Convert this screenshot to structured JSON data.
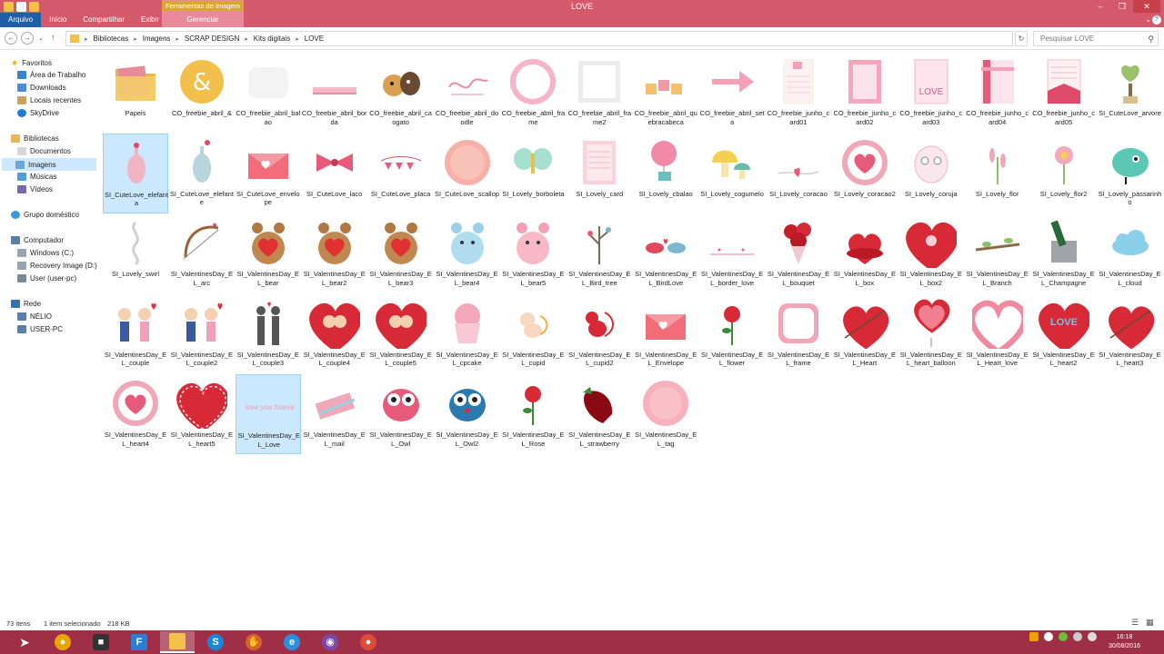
{
  "window": {
    "title": "LOVE",
    "context_group": "Ferramentas de Imagem",
    "tabs": [
      "Arquivo",
      "Início",
      "Compartilhar",
      "Exibir"
    ],
    "context_tab": "Gerenciar"
  },
  "address": {
    "segments": [
      "Bibliotecas",
      "Imagens",
      "SCRAP DESIGN",
      "Kits digitais",
      "LOVE"
    ],
    "search_placeholder": "Pesquisar LOVE"
  },
  "nav": {
    "favorites_title": "Favoritos",
    "favorites": [
      "Área de Trabalho",
      "Downloads",
      "Locais recentes",
      "SkyDrive"
    ],
    "libraries_title": "Bibliotecas",
    "libraries": [
      "Documentos",
      "Imagens",
      "Músicas",
      "Vídeos"
    ],
    "homegroup": "Grupo doméstico",
    "computer_title": "Computador",
    "computer": [
      "Windows (C:)",
      "Recovery Image (D:)",
      "User (user-pc)"
    ],
    "network_title": "Rede",
    "network": [
      "NÉLIO",
      "USER-PC"
    ]
  },
  "files": [
    {
      "name": "Papeis",
      "icon": "folder-icon"
    },
    {
      "name": "CO_freebie_abril_&",
      "icon": "ampersand-icon"
    },
    {
      "name": "CO_freebie_abril_balao",
      "icon": "blank-image-icon"
    },
    {
      "name": "CO_freebie_abril_borda",
      "icon": "border-strip-icon"
    },
    {
      "name": "CO_freebie_abril_caogato",
      "icon": "dog-cat-icon"
    },
    {
      "name": "CO_freebie_abril_doodle",
      "icon": "doodle-swirl-icon"
    },
    {
      "name": "CO_freebie_abril_frame",
      "icon": "scallop-frame-icon"
    },
    {
      "name": "CO_freebie_abril_frame2",
      "icon": "square-frame-icon"
    },
    {
      "name": "CO_freebie_abril_quebracabeca",
      "icon": "puzzle-icon"
    },
    {
      "name": "CO_freebie_abril_seta",
      "icon": "arrow-icon"
    },
    {
      "name": "CO_freebie_junho_card01",
      "icon": "card-icon"
    },
    {
      "name": "CO_freebie_junho_card02",
      "icon": "card-pink-icon"
    },
    {
      "name": "CO_freebie_junho_card03",
      "icon": "card-love-icon"
    },
    {
      "name": "CO_freebie_junho_card04",
      "icon": "card-ribbon-icon"
    },
    {
      "name": "CO_freebie_junho_card05",
      "icon": "card-lines-icon"
    },
    {
      "name": "SI_CuteLove_arvore",
      "icon": "tree-icon"
    },
    {
      "name": "SI_CuteLove_elefanta",
      "icon": "elephant-icon"
    },
    {
      "name": "SI_CuteLove_elefante",
      "icon": "elephant-blue-icon"
    },
    {
      "name": "SI_CuteLove_envelope",
      "icon": "envelope-icon"
    },
    {
      "name": "SI_CuteLove_laco",
      "icon": "bow-icon"
    },
    {
      "name": "SI_CuteLove_placa",
      "icon": "banner-icon"
    },
    {
      "name": "SI_CuteLove_scallop",
      "icon": "scallop-icon"
    },
    {
      "name": "SI_Lovely_borboleta",
      "icon": "butterfly-icon"
    },
    {
      "name": "SI_Lovely_card",
      "icon": "lined-card-icon"
    },
    {
      "name": "SI_Lovely_cbalao",
      "icon": "balloon-icon"
    },
    {
      "name": "SI_Lovely_cogumelo",
      "icon": "mushroom-icon"
    },
    {
      "name": "SI_Lovely_coracao",
      "icon": "heart-line-icon"
    },
    {
      "name": "SI_Lovely_coracao2",
      "icon": "heart-circle-icon"
    },
    {
      "name": "SI_Lovely_coruja",
      "icon": "owl-white-icon"
    },
    {
      "name": "SI_Lovely_flor",
      "icon": "flower-icon"
    },
    {
      "name": "SI_Lovely_flor2",
      "icon": "flower-pink-icon"
    },
    {
      "name": "SI_Lovely_passarinho",
      "icon": "bird-icon"
    },
    {
      "name": "SI_Lovely_swirl",
      "icon": "swirl-icon"
    },
    {
      "name": "SI_ValentinesDay_EL_arc",
      "icon": "bow-arrow-icon"
    },
    {
      "name": "SI_ValentinesDay_EL_bear",
      "icon": "bear-icon"
    },
    {
      "name": "SI_ValentinesDay_EL_bear2",
      "icon": "bear-icon"
    },
    {
      "name": "SI_ValentinesDay_EL_bear3",
      "icon": "bear-icon"
    },
    {
      "name": "SI_ValentinesDay_EL_bear4",
      "icon": "bear-blue-icon"
    },
    {
      "name": "SI_ValentinesDay_EL_bear5",
      "icon": "bear-pink-icon"
    },
    {
      "name": "SI_ValentinesDay_EL_Bird_tree",
      "icon": "bird-tree-icon"
    },
    {
      "name": "SI_ValentinesDay_EL_BirdLove",
      "icon": "birds-icon"
    },
    {
      "name": "SI_ValentinesDay_EL_border_love",
      "icon": "border-love-icon"
    },
    {
      "name": "SI_ValentinesDay_EL_bouquet",
      "icon": "bouquet-icon"
    },
    {
      "name": "SI_ValentinesDay_EL_box",
      "icon": "heart-box-icon"
    },
    {
      "name": "SI_ValentinesDay_EL_box2",
      "icon": "heart-box-bow-icon"
    },
    {
      "name": "SI_ValentinesDay_EL_Branch",
      "icon": "branch-icon"
    },
    {
      "name": "SI_ValentinesDay_EL_Champagne",
      "icon": "champagne-icon"
    },
    {
      "name": "SI_ValentinesDay_EL_cloud",
      "icon": "cloud-icon"
    },
    {
      "name": "SI_ValentinesDay_EL_couple",
      "icon": "couple-icon"
    },
    {
      "name": "SI_ValentinesDay_EL_couple2",
      "icon": "couple-icon"
    },
    {
      "name": "SI_ValentinesDay_EL_couple3",
      "icon": "silhouette-icon"
    },
    {
      "name": "SI_ValentinesDay_EL_couple4",
      "icon": "kiss-heart-icon"
    },
    {
      "name": "SI_ValentinesDay_EL_couple5",
      "icon": "kiss-heart-icon"
    },
    {
      "name": "SI_ValentinesDay_EL_cpcake",
      "icon": "cupcake-icon"
    },
    {
      "name": "SI_ValentinesDay_EL_cupid",
      "icon": "cupid-icon"
    },
    {
      "name": "SI_ValentinesDay_EL_cupid2",
      "icon": "cupid-red-icon"
    },
    {
      "name": "SI_ValentinesDay_EL_Envelope",
      "icon": "envelope-icon"
    },
    {
      "name": "SI_ValentinesDay_EL_flower",
      "icon": "rose-icon"
    },
    {
      "name": "SI_ValentinesDay_EL_frame",
      "icon": "frame-icon"
    },
    {
      "name": "SI_ValentinesDay_EL_Heart",
      "icon": "heart-arrow-icon"
    },
    {
      "name": "SI_ValentinesDay_EL_heart_balloon",
      "icon": "heart-balloon-icon"
    },
    {
      "name": "SI_ValentinesDay_EL_Heart_love",
      "icon": "heart-outline-icon"
    },
    {
      "name": "SI_ValentinesDay_EL_heart2",
      "icon": "love-heart-icon"
    },
    {
      "name": "SI_ValentinesDay_EL_heart3",
      "icon": "heart-arrow-icon"
    },
    {
      "name": "SI_ValentinesDay_EL_heart4",
      "icon": "heart-circle-icon"
    },
    {
      "name": "SI_ValentinesDay_EL_heart5",
      "icon": "heart-stitched-icon"
    },
    {
      "name": "SI_ValentinesDay_EL_Love",
      "icon": "love-text-icon"
    },
    {
      "name": "SI_ValentinesDay_EL_mail",
      "icon": "mail-icon"
    },
    {
      "name": "SI_ValentinesDay_EL_Owl",
      "icon": "owl-pink-icon"
    },
    {
      "name": "SI_ValentinesDay_EL_Owl2",
      "icon": "owl-blue-icon"
    },
    {
      "name": "SI_ValentinesDay_EL_Rose",
      "icon": "rose-icon"
    },
    {
      "name": "SI_ValentinesDay_EL_strawberry",
      "icon": "strawberry-icon"
    },
    {
      "name": "SI_ValentinesDay_EL_tag",
      "icon": "tag-icon"
    }
  ],
  "selected_indices": [
    16,
    66
  ],
  "status": {
    "count": "73 itens",
    "selected": "1 item selecionado",
    "size": "218 KB"
  },
  "clock": {
    "time": "16:18",
    "date": "30/08/2016"
  },
  "colors": {
    "accent": "#d45a6b",
    "taskbar": "#9e2f47",
    "selection": "#cce8ff"
  }
}
